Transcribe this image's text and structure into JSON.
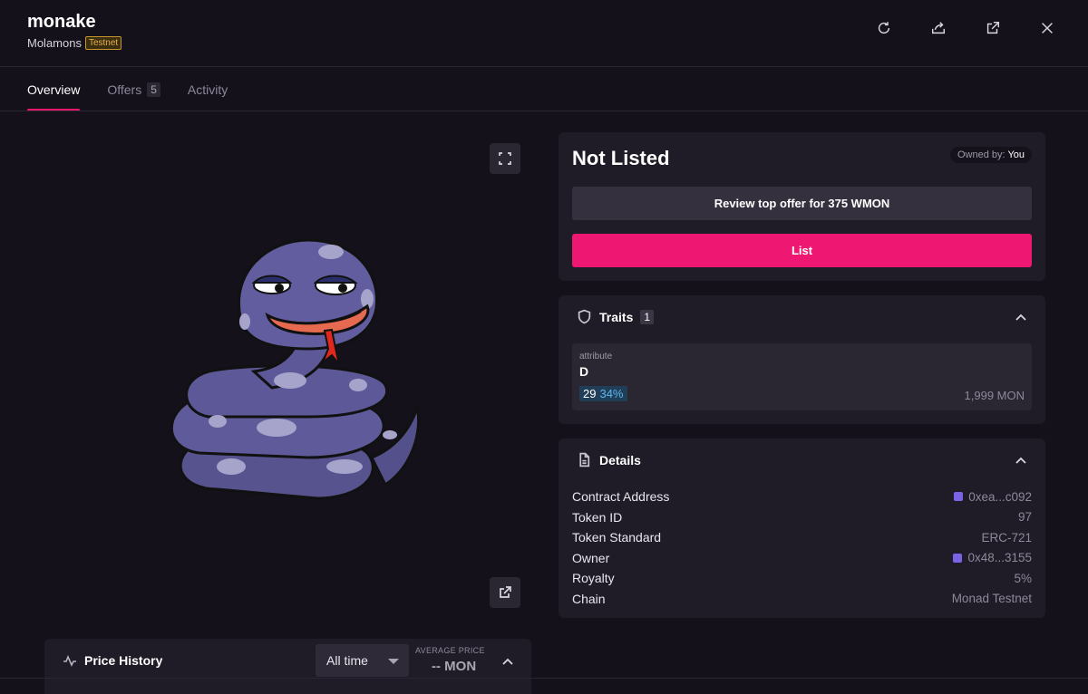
{
  "header": {
    "title": "monake",
    "collection": "Molamons",
    "network_badge": "Testnet",
    "icons": [
      "refresh-icon",
      "share-icon",
      "external-link-icon",
      "close-icon"
    ]
  },
  "tabs": [
    {
      "label": "Overview",
      "active": true
    },
    {
      "label": "Offers",
      "count": "5"
    },
    {
      "label": "Activity"
    }
  ],
  "listing": {
    "status": "Not Listed",
    "owned_label": "Owned by:",
    "owner_name": "You",
    "review_button": "Review top offer for 375 WMON",
    "list_button": "List"
  },
  "traits": {
    "title": "Traits",
    "count": "1",
    "items": [
      {
        "type": "attribute",
        "value": "D",
        "count": "29",
        "percent": "34%",
        "floor": "1,999 MON"
      }
    ]
  },
  "details": {
    "title": "Details",
    "rows": [
      {
        "label": "Contract Address",
        "value": "0xea...c092",
        "chain_icon": true
      },
      {
        "label": "Token ID",
        "value": "97"
      },
      {
        "label": "Token Standard",
        "value": "ERC-721"
      },
      {
        "label": "Owner",
        "value": "0x48...3155",
        "chain_icon": true
      },
      {
        "label": "Royalty",
        "value": "5%"
      },
      {
        "label": "Chain",
        "value": "Monad Testnet"
      }
    ]
  },
  "price_history": {
    "title": "Price History",
    "range_selected": "All time",
    "avg_label": "AVERAGE PRICE",
    "avg_value": "-- MON"
  },
  "colors": {
    "background": "#14111b",
    "panel": "#1f1c27",
    "accent": "#ee1771",
    "badge": "#e6b14a"
  }
}
